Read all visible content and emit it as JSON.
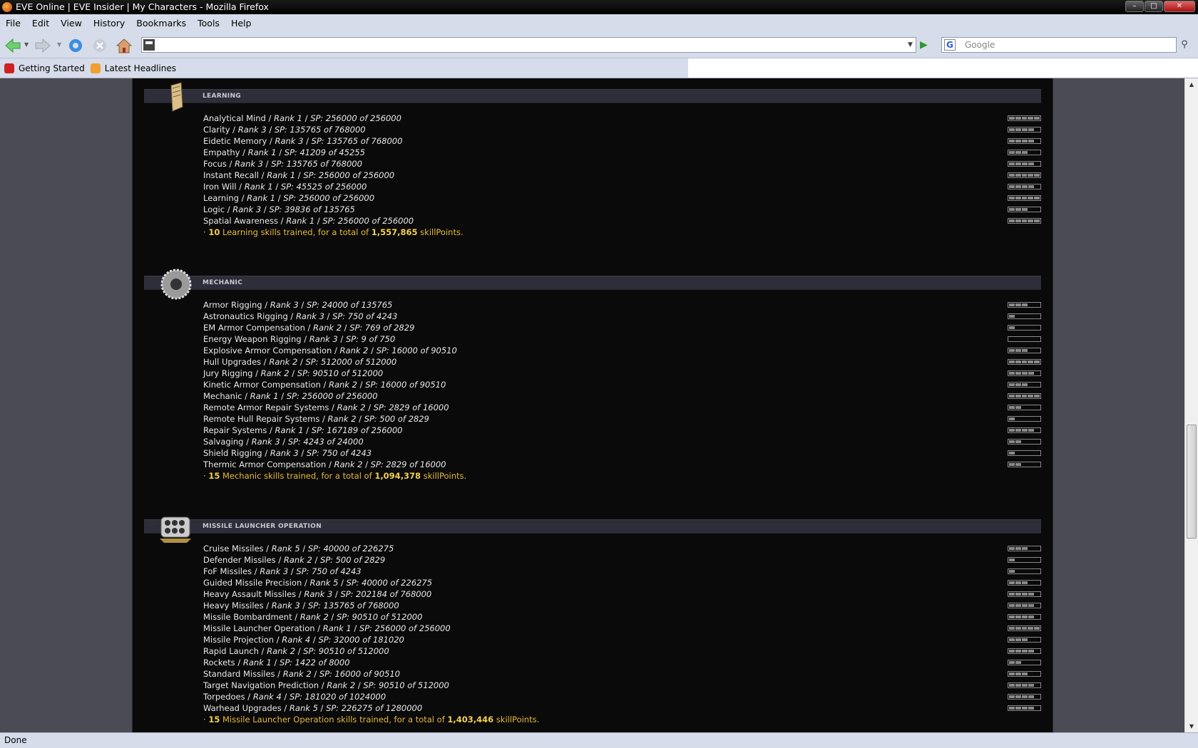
{
  "window": {
    "title": "EVE Online | EVE Insider | My Characters - Mozilla Firefox"
  },
  "menu": [
    "File",
    "Edit",
    "View",
    "History",
    "Bookmarks",
    "Tools",
    "Help"
  ],
  "navbar": {
    "url": "",
    "search_placeholder": "Google"
  },
  "bookmarks": [
    {
      "label": "Getting Started",
      "icon": "firefox-bookmark-icon"
    },
    {
      "label": "Latest Headlines",
      "icon": "rss-icon"
    }
  ],
  "status": "Done",
  "colors": {
    "accent": "#e6b93a",
    "panel": "#0a0a0b",
    "header": "#2e2e3a"
  },
  "sections": [
    {
      "title": "Learning",
      "icon": "book-icon",
      "skills": [
        {
          "name": "Analytical Mind",
          "rank": "Rank 1",
          "sp": "SP: 256000 of 256000",
          "level": 5
        },
        {
          "name": "Clarity",
          "rank": "Rank 3",
          "sp": "SP: 135765 of 768000",
          "level": 4
        },
        {
          "name": "Eidetic Memory",
          "rank": "Rank 3",
          "sp": "SP: 135765 of 768000",
          "level": 4
        },
        {
          "name": "Empathy",
          "rank": "Rank 1",
          "sp": "SP: 41209 of 45255",
          "level": 3
        },
        {
          "name": "Focus",
          "rank": "Rank 3",
          "sp": "SP: 135765 of 768000",
          "level": 4
        },
        {
          "name": "Instant Recall",
          "rank": "Rank 1",
          "sp": "SP: 256000 of 256000",
          "level": 5
        },
        {
          "name": "Iron Will",
          "rank": "Rank 1",
          "sp": "SP: 45525 of 256000",
          "level": 4
        },
        {
          "name": "Learning",
          "rank": "Rank 1",
          "sp": "SP: 256000 of 256000",
          "level": 5
        },
        {
          "name": "Logic",
          "rank": "Rank 3",
          "sp": "SP: 39836 of 135765",
          "level": 3
        },
        {
          "name": "Spatial Awareness",
          "rank": "Rank 1",
          "sp": "SP: 256000 of 256000",
          "level": 5
        }
      ],
      "total": {
        "count": "10",
        "text1": "Learning skills trained, for a total of",
        "points": "1,557,865",
        "text2": "skillPoints."
      }
    },
    {
      "title": "Mechanic",
      "icon": "gear-icon",
      "skills": [
        {
          "name": "Armor Rigging",
          "rank": "Rank 3",
          "sp": "SP: 24000 of 135765",
          "level": 3
        },
        {
          "name": "Astronautics Rigging",
          "rank": "Rank 3",
          "sp": "SP: 750 of 4243",
          "level": 1
        },
        {
          "name": "EM Armor Compensation",
          "rank": "Rank 2",
          "sp": "SP: 769 of 2829",
          "level": 1
        },
        {
          "name": "Energy Weapon Rigging",
          "rank": "Rank 3",
          "sp": "SP: 9 of 750",
          "level": 0
        },
        {
          "name": "Explosive Armor Compensation",
          "rank": "Rank 2",
          "sp": "SP: 16000 of 90510",
          "level": 3
        },
        {
          "name": "Hull Upgrades",
          "rank": "Rank 2",
          "sp": "SP: 512000 of 512000",
          "level": 5
        },
        {
          "name": "Jury Rigging",
          "rank": "Rank 2",
          "sp": "SP: 90510 of 512000",
          "level": 4
        },
        {
          "name": "Kinetic Armor Compensation",
          "rank": "Rank 2",
          "sp": "SP: 16000 of 90510",
          "level": 3
        },
        {
          "name": "Mechanic",
          "rank": "Rank 1",
          "sp": "SP: 256000 of 256000",
          "level": 5
        },
        {
          "name": "Remote Armor Repair Systems",
          "rank": "Rank 2",
          "sp": "SP: 2829 of 16000",
          "level": 2
        },
        {
          "name": "Remote Hull Repair Systems",
          "rank": "Rank 2",
          "sp": "SP: 500 of 2829",
          "level": 1
        },
        {
          "name": "Repair Systems",
          "rank": "Rank 1",
          "sp": "SP: 167189 of 256000",
          "level": 4
        },
        {
          "name": "Salvaging",
          "rank": "Rank 3",
          "sp": "SP: 4243 of 24000",
          "level": 2
        },
        {
          "name": "Shield Rigging",
          "rank": "Rank 3",
          "sp": "SP: 750 of 4243",
          "level": 1
        },
        {
          "name": "Thermic Armor Compensation",
          "rank": "Rank 2",
          "sp": "SP: 2829 of 16000",
          "level": 2
        }
      ],
      "total": {
        "count": "15",
        "text1": "Mechanic skills trained, for a total of",
        "points": "1,094,378",
        "text2": "skillPoints."
      }
    },
    {
      "title": "Missile Launcher Operation",
      "icon": "missile-launcher-icon",
      "skills": [
        {
          "name": "Cruise Missiles",
          "rank": "Rank 5",
          "sp": "SP: 40000 of 226275",
          "level": 3
        },
        {
          "name": "Defender Missiles",
          "rank": "Rank 2",
          "sp": "SP: 500 of 2829",
          "level": 1
        },
        {
          "name": "FoF Missiles",
          "rank": "Rank 3",
          "sp": "SP: 750 of 4243",
          "level": 1
        },
        {
          "name": "Guided Missile Precision",
          "rank": "Rank 5",
          "sp": "SP: 40000 of 226275",
          "level": 3
        },
        {
          "name": "Heavy Assault Missiles",
          "rank": "Rank 3",
          "sp": "SP: 202184 of 768000",
          "level": 4
        },
        {
          "name": "Heavy Missiles",
          "rank": "Rank 3",
          "sp": "SP: 135765 of 768000",
          "level": 4
        },
        {
          "name": "Missile Bombardment",
          "rank": "Rank 2",
          "sp": "SP: 90510 of 512000",
          "level": 4
        },
        {
          "name": "Missile Launcher Operation",
          "rank": "Rank 1",
          "sp": "SP: 256000 of 256000",
          "level": 5
        },
        {
          "name": "Missile Projection",
          "rank": "Rank 4",
          "sp": "SP: 32000 of 181020",
          "level": 3
        },
        {
          "name": "Rapid Launch",
          "rank": "Rank 2",
          "sp": "SP: 90510 of 512000",
          "level": 4
        },
        {
          "name": "Rockets",
          "rank": "Rank 1",
          "sp": "SP: 1422 of 8000",
          "level": 2
        },
        {
          "name": "Standard Missiles",
          "rank": "Rank 2",
          "sp": "SP: 16000 of 90510",
          "level": 3
        },
        {
          "name": "Target Navigation Prediction",
          "rank": "Rank 2",
          "sp": "SP: 90510 of 512000",
          "level": 4
        },
        {
          "name": "Torpedoes",
          "rank": "Rank 4",
          "sp": "SP: 181020 of 1024000",
          "level": 4
        },
        {
          "name": "Warhead Upgrades",
          "rank": "Rank 5",
          "sp": "SP: 226275 of 1280000",
          "level": 4
        }
      ],
      "total": {
        "count": "15",
        "text1": "Missile Launcher Operation skills trained, for a total of",
        "points": "1,403,446",
        "text2": "skillPoints."
      }
    }
  ]
}
